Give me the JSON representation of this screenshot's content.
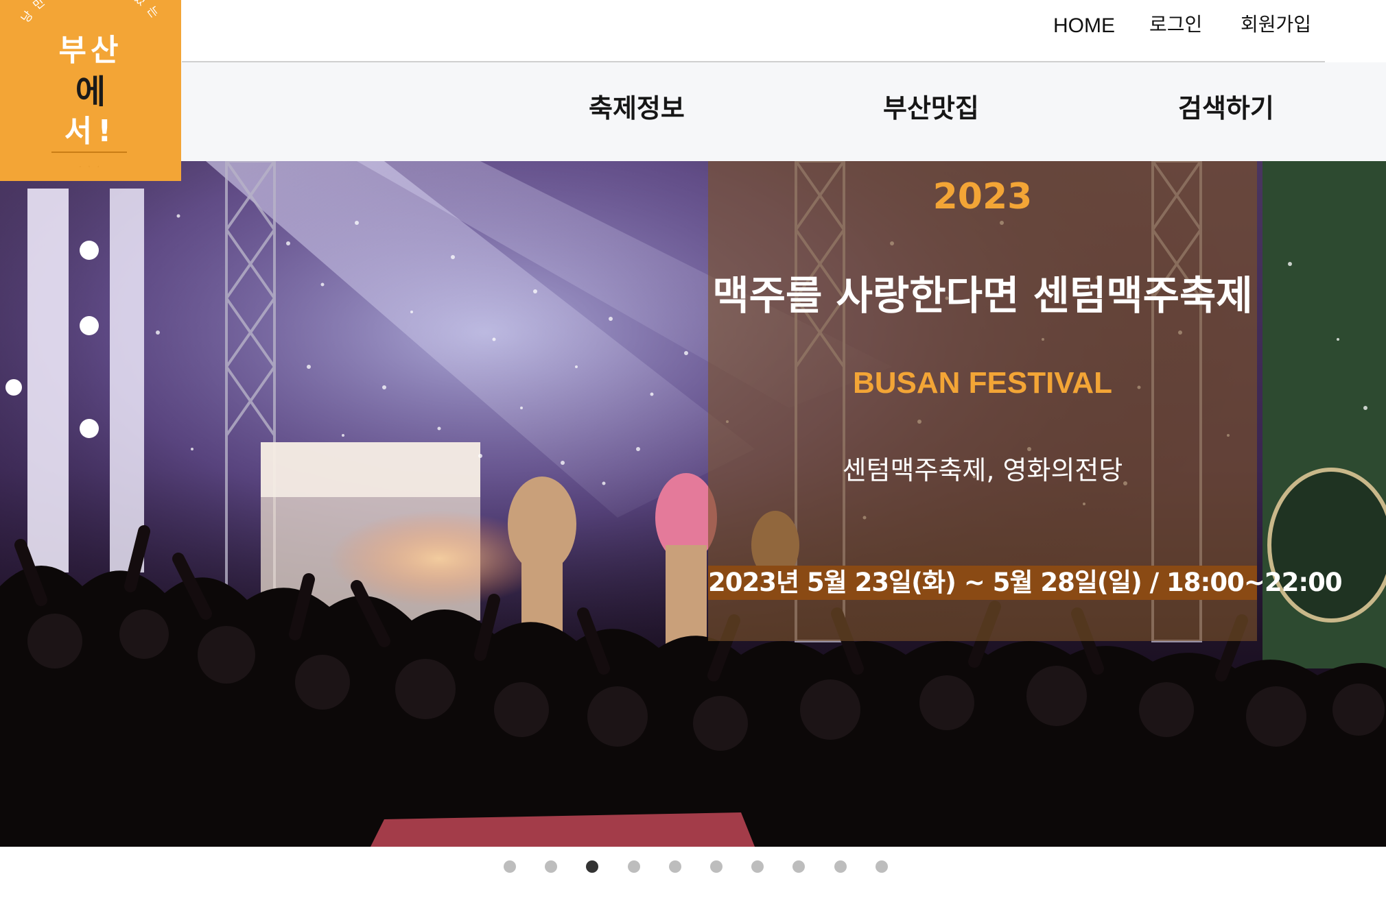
{
  "utility_nav": {
    "home": "HOME",
    "login": "로그인",
    "signup": "회원가입"
  },
  "main_nav": {
    "items": [
      "축제정보",
      "부산맛집",
      "검색하기"
    ]
  },
  "logo": {
    "arc_text": "낭만과 추억이 있는",
    "line1": "부산",
    "line2": "에",
    "line3": "서!",
    "colors": {
      "background": "#f3a536",
      "text": "#ffffff",
      "accent_text": "#1a1a1a"
    }
  },
  "hero": {
    "year": "2023",
    "title": "맥주를 사랑한다면 센텀맥주축제",
    "subtitle": "BUSAN FESTIVAL",
    "venue": "센텀맥주축제, 영화의전당",
    "date": "2023년 5월 23일(화) ~ 5월 28일(일) / 18:00~22:00",
    "image_icon": "concert-photo",
    "colors": {
      "accent": "#f3a536",
      "panel": "#7a5228",
      "date_bar": "#8a4a14"
    }
  },
  "carousel": {
    "total": 10,
    "active": 3
  }
}
